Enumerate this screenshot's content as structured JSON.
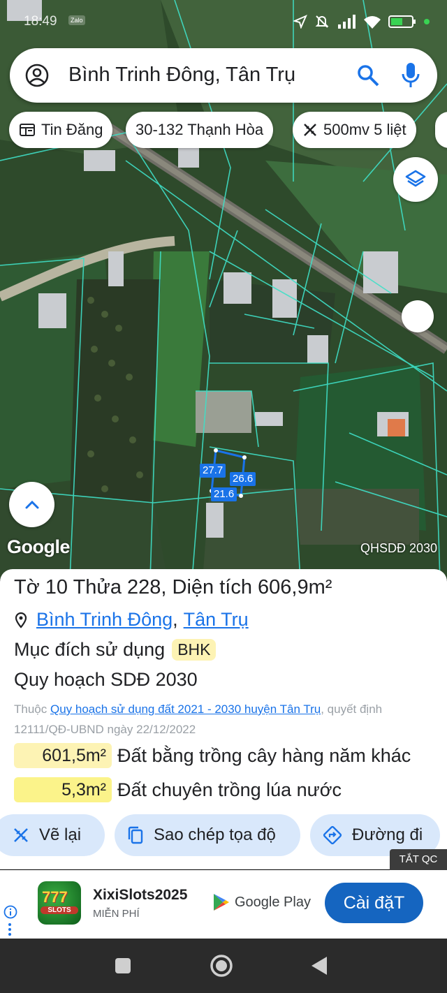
{
  "status_bar": {
    "time": "18:49",
    "app_badge": "Zalo"
  },
  "search": {
    "query": "Bình Trinh Đông, Tân Trụ"
  },
  "chips": [
    {
      "label": "Tin Đăng",
      "icon": "newspaper-icon"
    },
    {
      "label": "30-132 Thạnh Hòa",
      "icon": ""
    },
    {
      "label": "500mv 5 liệt",
      "icon": "ruler-icon"
    }
  ],
  "map": {
    "attribution": "Google",
    "layer_name": "QHSDĐ 2030",
    "parcel_edges": [
      "27.7",
      "26.6",
      "21.6"
    ]
  },
  "parcel": {
    "title": "Tờ 10 Thửa 228, Diện tích 606,9m²",
    "commune": "Bình Trinh Đông",
    "separator": ",",
    "district": "Tân Trụ",
    "purpose_label": "Mục đích sử dụng",
    "purpose_code": "BHK",
    "plan_title": "Quy hoạch SDĐ 2030",
    "plan_prefix": "Thuộc",
    "plan_link": "Quy hoạch sử dụng đất 2021 - 2030 huyện Tân Trụ",
    "plan_suffix": ", quyết định 12111/QĐ-UBND ngày 22/12/2022",
    "land_uses": [
      {
        "area": "601,5m²",
        "label": "Đất bằng trồng cây hàng năm khác",
        "color": "#fdf3b4"
      },
      {
        "area": "5,3m²",
        "label": "Đất chuyên trồng lúa nước",
        "color": "#fbf38a"
      }
    ]
  },
  "actions": [
    {
      "label": "Vẽ lại",
      "icon": "ruler-icon"
    },
    {
      "label": "Sao chép tọa độ",
      "icon": "copy-icon"
    },
    {
      "label": "Đường đi",
      "icon": "directions-icon"
    }
  ],
  "ad": {
    "tag": "TẮT QC",
    "icon_text": "777",
    "icon_sub": "SLOTS",
    "title": "XixiSlots2025",
    "subtitle": "MIỄN PHÍ",
    "store": "Google Play",
    "install": "Cài đặT"
  },
  "colors": {
    "accent": "#1a73e8",
    "parcel_line": "#3fe0c8",
    "install_button": "#1565c0"
  }
}
